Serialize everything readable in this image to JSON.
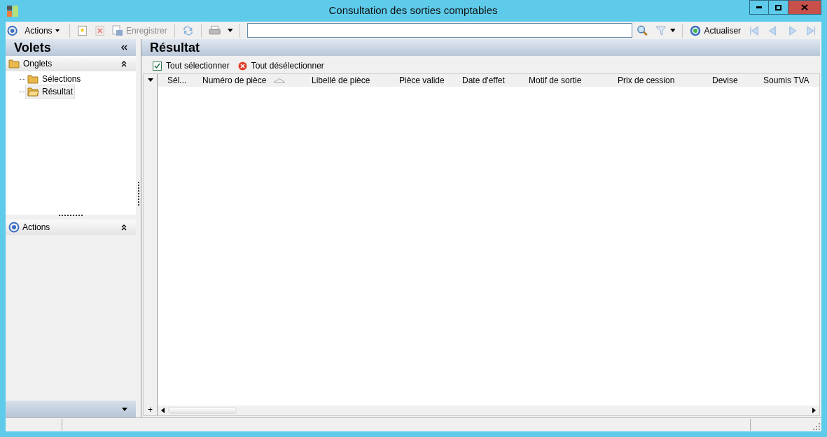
{
  "window": {
    "title": "Consultation des sorties comptables"
  },
  "toolbar": {
    "actions_menu": "Actions",
    "save": "Enregistrer",
    "refresh": "Actualiser"
  },
  "sidebar": {
    "title": "Volets",
    "tabs_section": {
      "title": "Onglets",
      "expanded": true,
      "items": [
        {
          "label": "Sélections",
          "selected": false
        },
        {
          "label": "Résultat",
          "selected": true
        }
      ]
    },
    "actions_section": {
      "title": "Actions",
      "expanded": true
    }
  },
  "main": {
    "title": "Résultat",
    "select_all": "Tout sélectionner",
    "deselect_all": "Tout désélectionner",
    "columns": [
      {
        "label": "Sél...",
        "sorted": false
      },
      {
        "label": "Numéro de pièce",
        "sorted": true
      },
      {
        "label": "Libellé de pièce",
        "sorted": false
      },
      {
        "label": "Pièce valide",
        "sorted": false
      },
      {
        "label": "Date d'effet",
        "sorted": false
      },
      {
        "label": "Motif de sortie",
        "sorted": false
      },
      {
        "label": "Prix de cession",
        "sorted": false
      },
      {
        "label": "Devise",
        "sorted": false
      },
      {
        "label": "Soumis TVA",
        "sorted": false
      }
    ],
    "add_row": "+"
  }
}
